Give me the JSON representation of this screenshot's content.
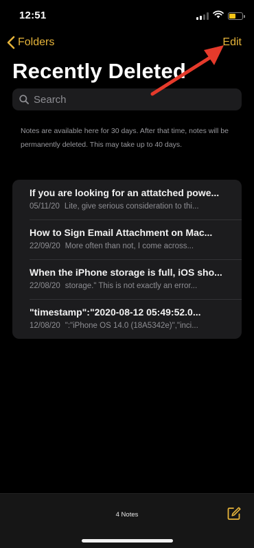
{
  "status_bar": {
    "time": "12:51"
  },
  "nav": {
    "back_label": "Folders",
    "edit_label": "Edit"
  },
  "page": {
    "title": "Recently Deleted"
  },
  "search": {
    "placeholder": "Search"
  },
  "info": {
    "text": "Notes are available here for 30 days. After that time, notes will be permanently deleted. This may take up to 40 days."
  },
  "notes": [
    {
      "title": "If you are looking for an attatched powe...",
      "date": "05/11/20",
      "preview": "Lite, give serious consideration to thi..."
    },
    {
      "title": "How to Sign Email Attachment on Mac...",
      "date": "22/09/20",
      "preview": "More often than not, I come across..."
    },
    {
      "title": "When the iPhone storage is full, iOS sho...",
      "date": "22/08/20",
      "preview": "storage.\" This is not exactly an error..."
    },
    {
      "title": "\"timestamp\":\"2020-08-12 05:49:52.0...",
      "date": "12/08/20",
      "preview": "\":\"iPhone OS 14.0 (18A5342e)\",\"inci..."
    }
  ],
  "toolbar": {
    "notes_count": "4 Notes"
  },
  "colors": {
    "accent": "#e6b43a",
    "annotation": "#e53a2b",
    "background": "#000000",
    "card": "#1c1c1e"
  },
  "icons": {
    "back": "chevron-left-icon",
    "search": "search-icon",
    "compose": "compose-icon",
    "wifi": "wifi-icon",
    "battery": "battery-icon",
    "signal": "signal-icon"
  },
  "battery_level": 0.5
}
